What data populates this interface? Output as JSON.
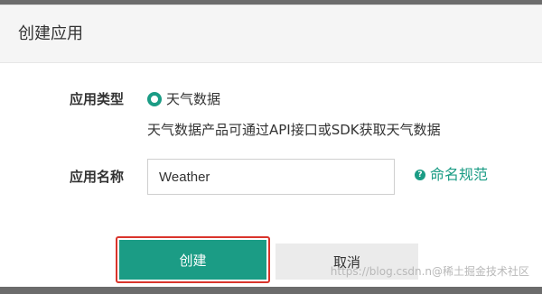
{
  "dialog": {
    "title": "创建应用",
    "type_label": "应用类型",
    "type_option": "天气数据",
    "type_description": "天气数据产品可通过API接口或SDK获取天气数据",
    "name_label": "应用名称",
    "name_value": "Weather",
    "help_icon_glyph": "?",
    "help_link": "命名规范",
    "create_label": "创建",
    "cancel_label": "取消"
  },
  "watermark": "https://blog.csdn.n@稀土掘金技术社区",
  "colors": {
    "accent": "#1b9c85",
    "highlight_outline": "#d9342b"
  }
}
